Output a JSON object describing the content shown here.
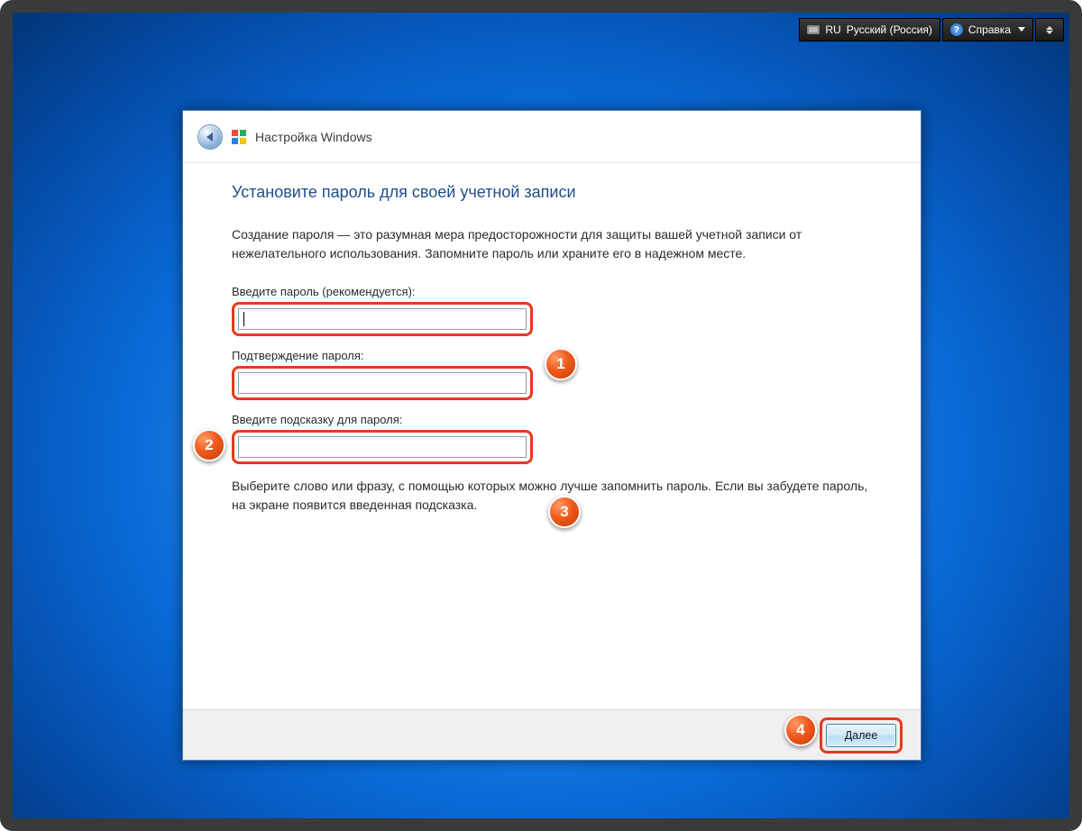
{
  "topbar": {
    "lang_code": "RU",
    "lang_name": "Русский (Россия)",
    "help_label": "Справка"
  },
  "window": {
    "title": "Настройка Windows"
  },
  "page": {
    "heading": "Установите пароль для своей учетной записи",
    "description": "Создание пароля — это разумная мера предосторожности для защиты вашей учетной записи от нежелательного использования. Запомните пароль или храните его в надежном месте.",
    "password_label": "Введите пароль (рекомендуется):",
    "confirm_label": "Подтверждение пароля:",
    "hint_label": "Введите подсказку для пароля:",
    "hint_desc": "Выберите слово или фразу, с помощью которых можно лучше запомнить пароль. Если вы забудете пароль, на экране появится введенная подсказка.",
    "password_value": "",
    "confirm_value": "",
    "hint_value": ""
  },
  "footer": {
    "next_label": "Далее"
  },
  "annotations": {
    "a1": "1",
    "a2": "2",
    "a3": "3",
    "a4": "4"
  }
}
